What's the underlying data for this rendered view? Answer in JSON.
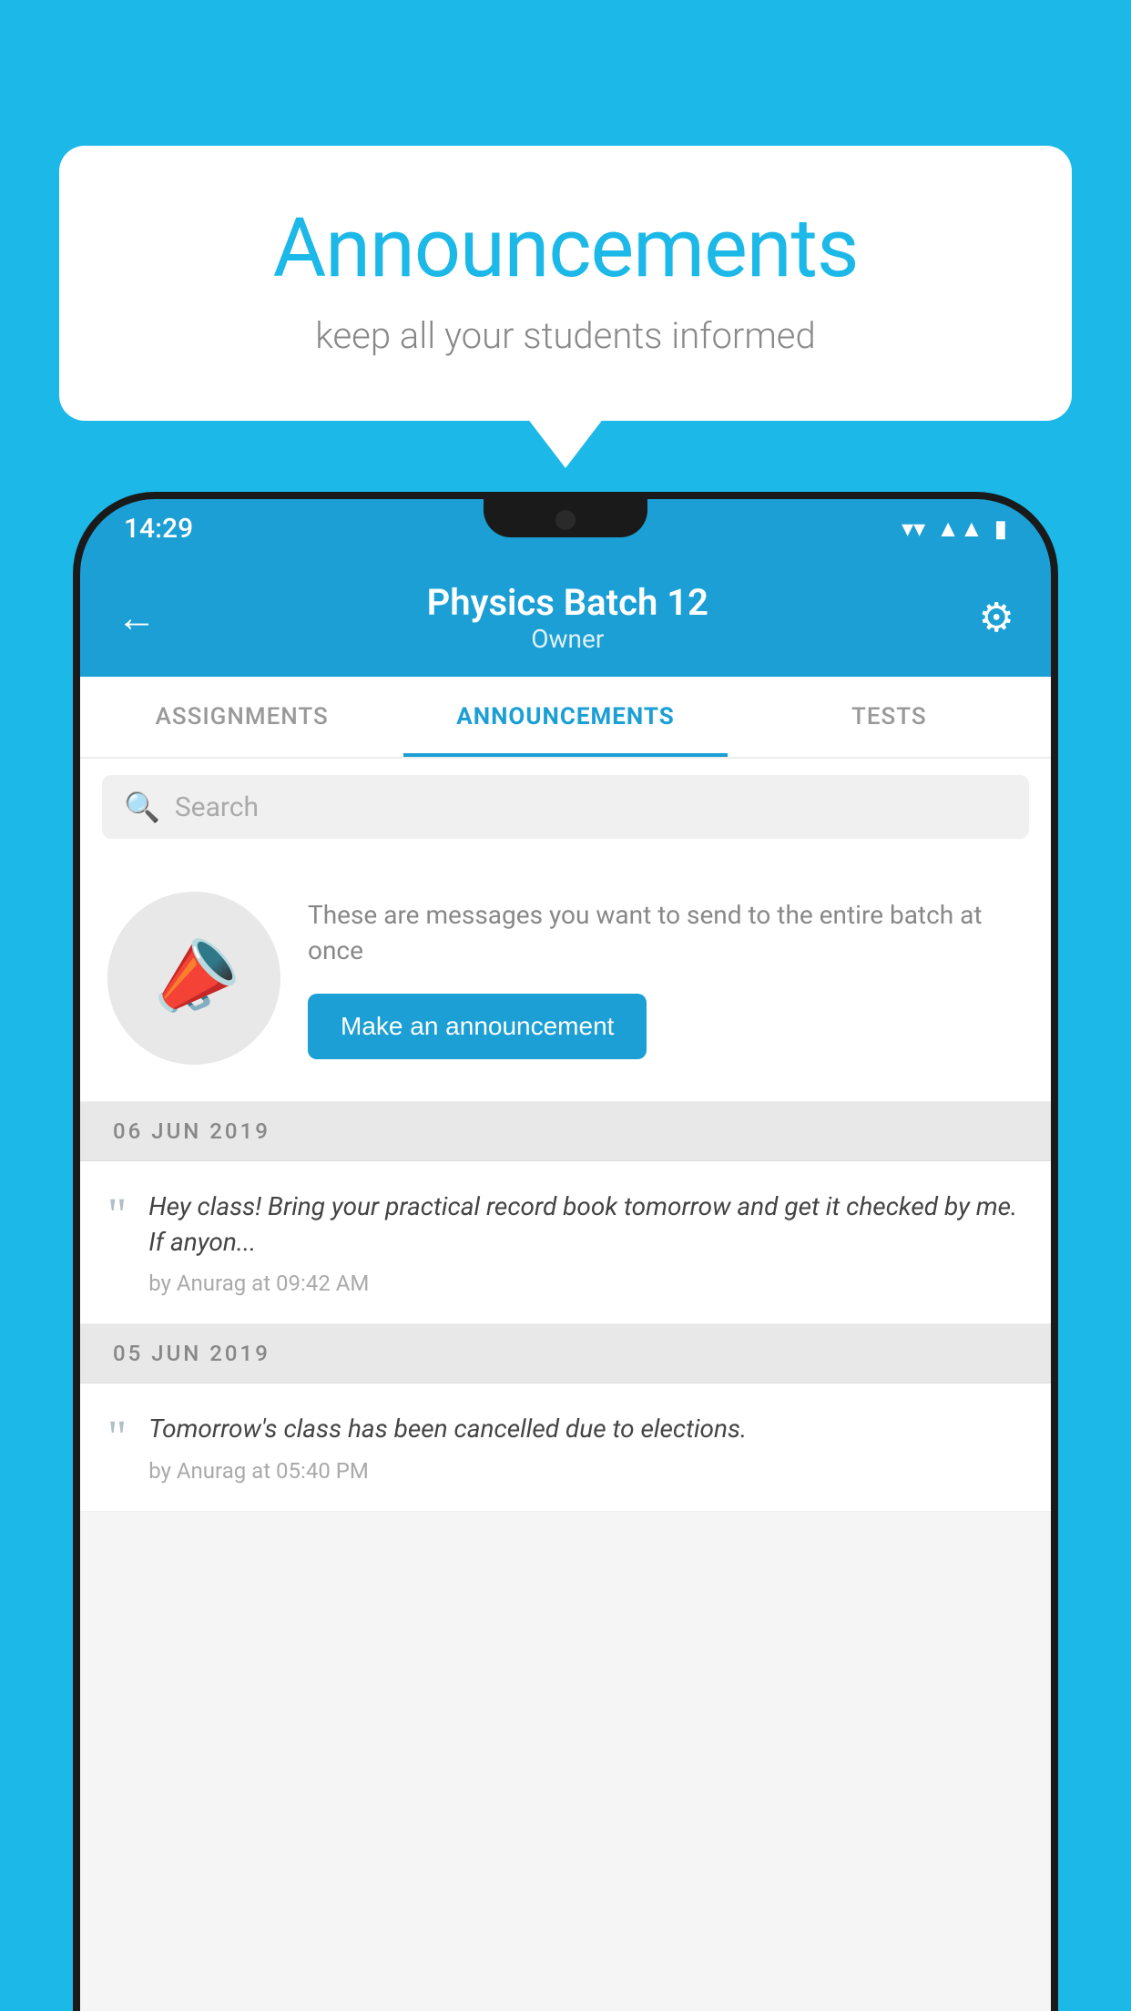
{
  "bubble": {
    "title": "Announcements",
    "subtitle": "keep all your students informed"
  },
  "status_bar": {
    "time": "14:29",
    "wifi": "▼",
    "signal": "▲",
    "battery": "▮"
  },
  "header": {
    "title": "Physics Batch 12",
    "subtitle": "Owner",
    "back_label": "←",
    "gear_label": "⚙"
  },
  "tabs": [
    {
      "label": "ASSIGNMENTS",
      "active": false
    },
    {
      "label": "ANNOUNCEMENTS",
      "active": true
    },
    {
      "label": "TESTS",
      "active": false
    }
  ],
  "search": {
    "placeholder": "Search"
  },
  "intro": {
    "description": "These are messages you want to send to the entire batch at once",
    "button_label": "Make an announcement"
  },
  "announcements": [
    {
      "date": "06  JUN  2019",
      "text": "Hey class! Bring your practical record book tomorrow and get it checked by me. If anyon...",
      "meta": "by Anurag at 09:42 AM"
    },
    {
      "date": "05  JUN  2019",
      "text": "Tomorrow's class has been cancelled due to elections.",
      "meta": "by Anurag at 05:40 PM"
    }
  ]
}
